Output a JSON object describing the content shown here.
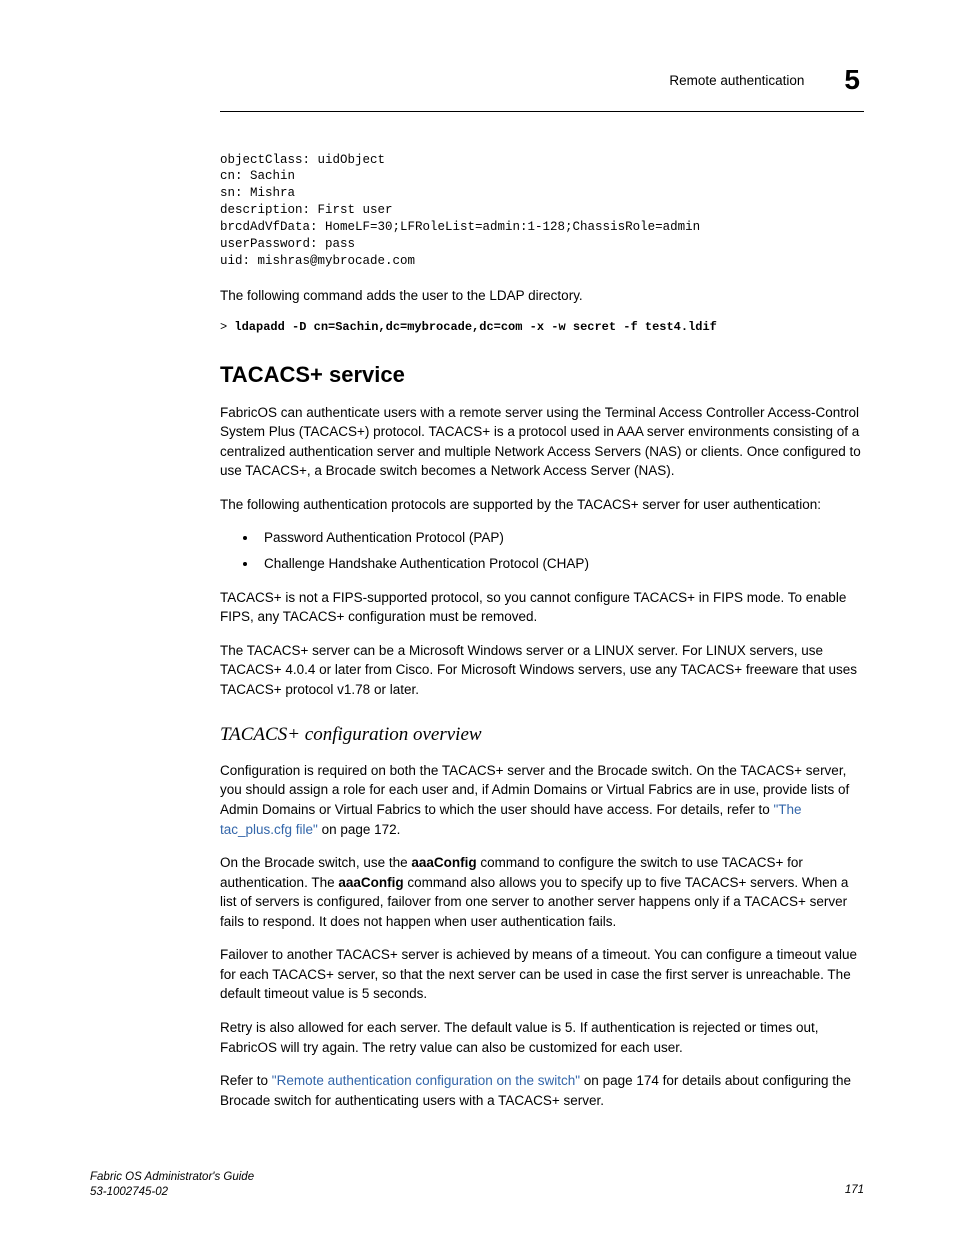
{
  "header": {
    "running_title": "Remote authentication",
    "chapter_number": "5"
  },
  "ldif": "objectClass: uidObject\ncn: Sachin\nsn: Mishra\ndescription: First user\nbrcdAdVfData: HomeLF=30;LFRoleList=admin:1-128;ChassisRole=admin\nuserPassword: pass\nuid: mishras@mybrocade.com",
  "intro1": "The following command adds the user to the LDAP directory.",
  "cmd_prompt": "> ",
  "cmd_text": "ldapadd -D cn=Sachin,dc=mybrocade,dc=com -x -w secret -f test4.ldif",
  "section_title": "TACACS+ service",
  "p1": "FabricOS can authenticate users with a remote server using the Terminal Access Controller Access-Control System Plus (TACACS+) protocol. TACACS+ is a protocol used in AAA server environments consisting of a centralized authentication server and multiple Network Access Servers (NAS) or clients. Once configured to use TACACS+, a Brocade switch becomes a Network Access Server (NAS).",
  "p2": "The following authentication protocols are supported by the TACACS+ server for user authentication:",
  "bullets": [
    "Password Authentication Protocol (PAP)",
    "Challenge Handshake Authentication Protocol (CHAP)"
  ],
  "p3": "TACACS+ is not a FIPS-supported protocol, so you cannot configure TACACS+ in FIPS mode. To enable FIPS, any TACACS+ configuration must be removed.",
  "p4": "The TACACS+ server can be a Microsoft Windows server or a LINUX server. For LINUX servers, use TACACS+ 4.0.4 or later from Cisco. For Microsoft Windows servers, use any TACACS+ freeware that uses TACACS+ protocol v1.78 or later.",
  "subsection_title": "TACACS+ configuration overview",
  "p5_a": "Configuration is required on both the TACACS+ server and the Brocade switch. On the TACACS+ server, you should assign a role for each user and, if Admin Domains or Virtual Fabrics are in use, provide lists of Admin Domains or Virtual Fabrics to which the user should have access. For details, refer to ",
  "p5_link": "\"The tac_plus.cfg file\"",
  "p5_b": " on page 172.",
  "p6_a": "On the Brocade switch, use the ",
  "p6_cmd1": "aaaConfig",
  "p6_b": " command to configure the switch to use TACACS+ for authentication. The ",
  "p6_cmd2": "aaaConfig",
  "p6_c": " command also allows you to specify up to five TACACS+ servers. When a list of servers is configured, failover from one server to another server happens only if a TACACS+ server fails to respond. It does not happen when user authentication fails.",
  "p7": "Failover to another TACACS+ server is achieved by means of a timeout. You can configure a timeout value for each TACACS+ server, so that the next server can be used in case the first server is unreachable. The default timeout value is 5 seconds.",
  "p8": "Retry is also allowed for each server. The default value is 5. If authentication is rejected or times out, FabricOS will try again. The retry value can also be customized for each user.",
  "p9_a": "Refer to ",
  "p9_link": "\"Remote authentication configuration on the switch\"",
  "p9_b": " on page 174 for details about configuring the Brocade switch for authenticating users with a TACACS+ server.",
  "footer": {
    "guide": "Fabric OS Administrator's Guide",
    "docnum": "53-1002745-02",
    "page": "171"
  }
}
